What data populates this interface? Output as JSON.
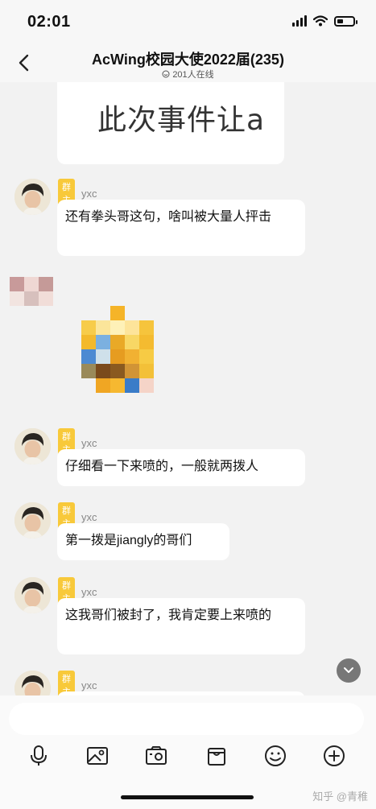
{
  "status": {
    "time": "02:01"
  },
  "header": {
    "title": "AcWing校园大使2022届(235)",
    "online": "201人在线"
  },
  "image_message": {
    "text": "此次事件让a"
  },
  "messages": [
    {
      "badge": "群主",
      "sender": "yxc",
      "text": "还有拳头哥这句，啥叫被大量人抨击"
    },
    {
      "badge": "群主",
      "sender": "yxc",
      "text": "仔细看一下来喷的，一般就两拨人"
    },
    {
      "badge": "群主",
      "sender": "yxc",
      "text": "第一拨是jiangly的哥们"
    },
    {
      "badge": "群主",
      "sender": "yxc",
      "text": "这我哥们被封了，我肯定要上来喷的"
    },
    {
      "badge": "群主",
      "sender": "yxc",
      "text": ""
    }
  ],
  "watermark": "知乎 @青稚",
  "icons": {
    "back": "back-arrow-icon",
    "scroll": "scroll-down-icon",
    "tools": [
      "microphone-icon",
      "image-icon",
      "camera-icon",
      "gift-icon",
      "emoji-icon",
      "plus-icon"
    ]
  }
}
